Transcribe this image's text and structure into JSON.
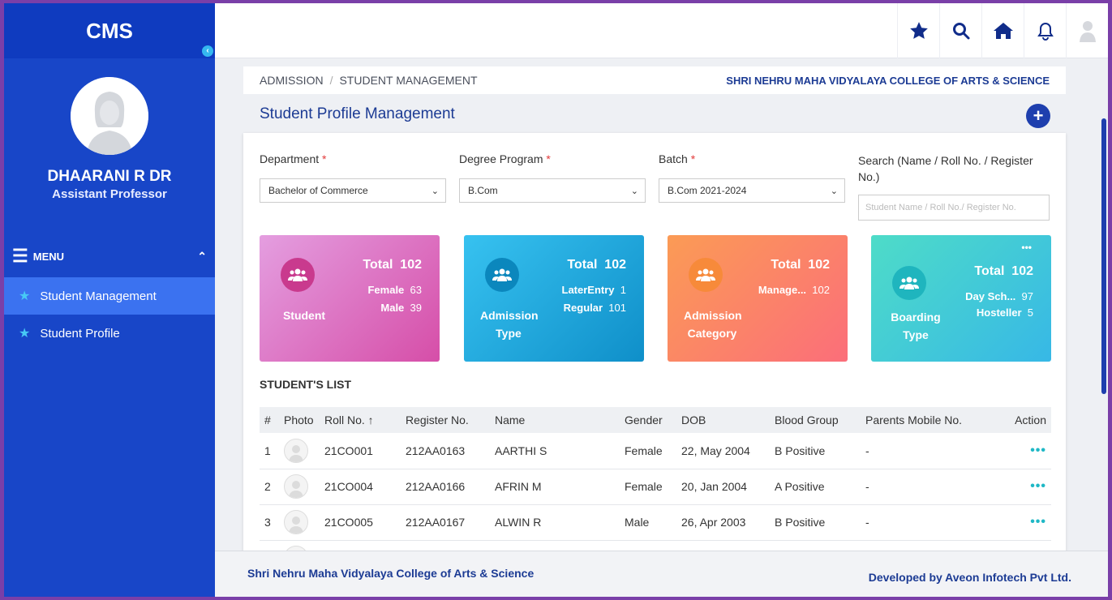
{
  "sidebar": {
    "brand": "CMS",
    "user_name": "DHAARANI R DR",
    "user_role": "Assistant Professor",
    "menu_label": "MENU",
    "items": [
      {
        "label": "Student Management",
        "active": true
      },
      {
        "label": "Student Profile",
        "active": false
      }
    ]
  },
  "topbar": {
    "icons": [
      "star-icon",
      "search-icon",
      "home-icon",
      "bell-icon",
      "user-avatar-icon"
    ]
  },
  "breadcrumb": {
    "items": [
      "ADMISSION",
      "STUDENT MANAGEMENT"
    ],
    "college": "SHRI NEHRU MAHA VIDYALAYA COLLEGE OF ARTS & SCIENCE"
  },
  "page": {
    "title": "Student Profile Management"
  },
  "filters": {
    "department": {
      "label": "Department",
      "value": "Bachelor of Commerce"
    },
    "degree": {
      "label": "Degree Program",
      "value": "B.Com"
    },
    "batch": {
      "label": "Batch",
      "value": "B.Com 2021-2024"
    },
    "search": {
      "label": "Search (Name / Roll No. / Register No.)",
      "placeholder": "Student Name / Roll No./ Register No."
    }
  },
  "cards": [
    {
      "caption": "Student",
      "total_label": "Total",
      "total": "102",
      "lines": [
        {
          "k": "Female",
          "v": "63"
        },
        {
          "k": "Male",
          "v": "39"
        }
      ]
    },
    {
      "caption": "Admission Type",
      "total_label": "Total",
      "total": "102",
      "lines": [
        {
          "k": "LaterEntry",
          "v": "1"
        },
        {
          "k": "Regular",
          "v": "101"
        }
      ]
    },
    {
      "caption": "Admission Category",
      "total_label": "Total",
      "total": "102",
      "lines": [
        {
          "k": "Manage...",
          "v": "102"
        }
      ]
    },
    {
      "caption": "Boarding Type",
      "total_label": "Total",
      "total": "102",
      "more": "•••",
      "lines": [
        {
          "k": "Day Sch...",
          "v": "97"
        },
        {
          "k": "Hosteller",
          "v": "5"
        }
      ]
    }
  ],
  "list": {
    "title": "STUDENT'S LIST",
    "columns": [
      "#",
      "Photo",
      "Roll No. ↑",
      "Register No.",
      "Name",
      "Gender",
      "DOB",
      "Blood Group",
      "Parents Mobile No.",
      "Action"
    ],
    "rows": [
      {
        "num": "1",
        "roll": "21CO001",
        "reg": "212AA0163",
        "name": "AARTHI S",
        "gender": "Female",
        "dob": "22, May 2004",
        "blood": "B Positive",
        "mobile": "-"
      },
      {
        "num": "2",
        "roll": "21CO004",
        "reg": "212AA0166",
        "name": "AFRIN M",
        "gender": "Female",
        "dob": "20, Jan 2004",
        "blood": "A Positive",
        "mobile": "-"
      },
      {
        "num": "3",
        "roll": "21CO005",
        "reg": "212AA0167",
        "name": "ALWIN R",
        "gender": "Male",
        "dob": "26, Apr 2003",
        "blood": "B Positive",
        "mobile": "-"
      }
    ],
    "action_glyph": "•••"
  },
  "footer": {
    "left": "Shri Nehru Maha Vidyalaya College of Arts & Science",
    "right": "Developed by Aveon Infotech Pvt Ltd."
  },
  "colors": {
    "sidebar": "#1846c8",
    "accent": "#1c3b94",
    "card_student": "#d44fa6",
    "card_type": "#1a9ee0",
    "card_category": "#fb7a6e",
    "card_boarding": "#3ccdd8"
  }
}
